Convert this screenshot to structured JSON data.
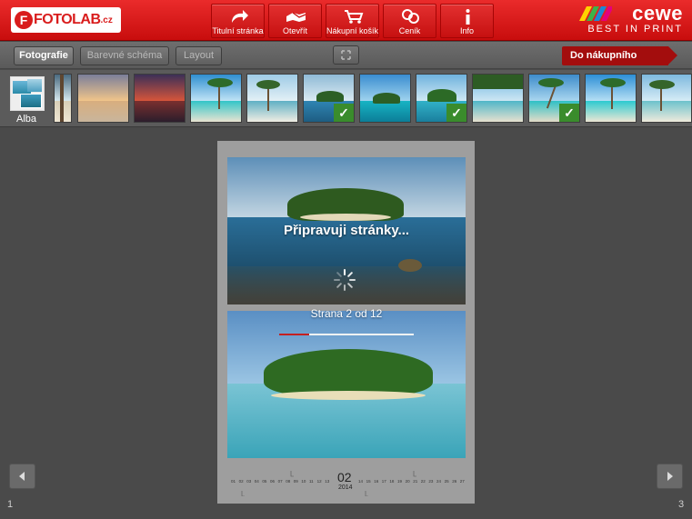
{
  "header": {
    "logo_text": "FOTOLAB",
    "logo_suffix": ".cz",
    "logo_badge": "F",
    "nav": [
      {
        "label": "Titulní stránka",
        "icon": "home-arrow-icon"
      },
      {
        "label": "Otevřít",
        "icon": "open-hand-icon"
      },
      {
        "label": "Nákupní košík",
        "icon": "cart-icon"
      },
      {
        "label": "Ceník",
        "icon": "coins-icon"
      },
      {
        "label": "Info",
        "icon": "info-icon"
      }
    ],
    "brand_right": "cewe",
    "brand_tagline": "BEST IN PRINT"
  },
  "toolbar": {
    "tabs": [
      {
        "label": "Fotografie",
        "active": true
      },
      {
        "label": "Barevné schéma",
        "active": false
      },
      {
        "label": "Layout",
        "active": false
      }
    ],
    "expand_icon": "expand-icon",
    "cart_button": "Do nákupního košíku"
  },
  "strip": {
    "albums_label": "Alba",
    "thumbnails": [
      {
        "name": "palm-edge",
        "checked": false
      },
      {
        "name": "sunset-beach",
        "checked": false
      },
      {
        "name": "sunset-red",
        "checked": false
      },
      {
        "name": "palm-beach",
        "checked": false
      },
      {
        "name": "palm-shore",
        "checked": false
      },
      {
        "name": "island-underwater-1",
        "checked": true
      },
      {
        "name": "island-lagoon",
        "checked": false
      },
      {
        "name": "island-underwater-2",
        "checked": true
      },
      {
        "name": "palm-canopy",
        "checked": false
      },
      {
        "name": "palm-lean",
        "checked": true
      },
      {
        "name": "palm-sand",
        "checked": false
      },
      {
        "name": "palm-edge-right",
        "checked": false
      }
    ]
  },
  "preview": {
    "loading_title": "Připravuji stránky...",
    "progress_label": "Strana 2 od 12",
    "progress_fraction": 0.22,
    "calendar_month": "02",
    "calendar_year": "2014",
    "day_numbers_left": [
      "01",
      "02",
      "03",
      "04",
      "05",
      "06",
      "07",
      "08",
      "09",
      "10",
      "11",
      "12",
      "13"
    ],
    "day_numbers_right": [
      "14",
      "15",
      "16",
      "17",
      "18",
      "19",
      "20",
      "21",
      "22",
      "23",
      "24",
      "25",
      "26",
      "27",
      "28"
    ]
  },
  "pagination": {
    "left_page": "1",
    "right_page": "3",
    "prev_icon": "chevron-left-icon",
    "next_icon": "chevron-right-icon"
  },
  "colors": {
    "header_red": "#d41a1a",
    "cart_red": "#a30d0d",
    "check_green": "#3a8c2c",
    "progress_red": "#c52020"
  }
}
